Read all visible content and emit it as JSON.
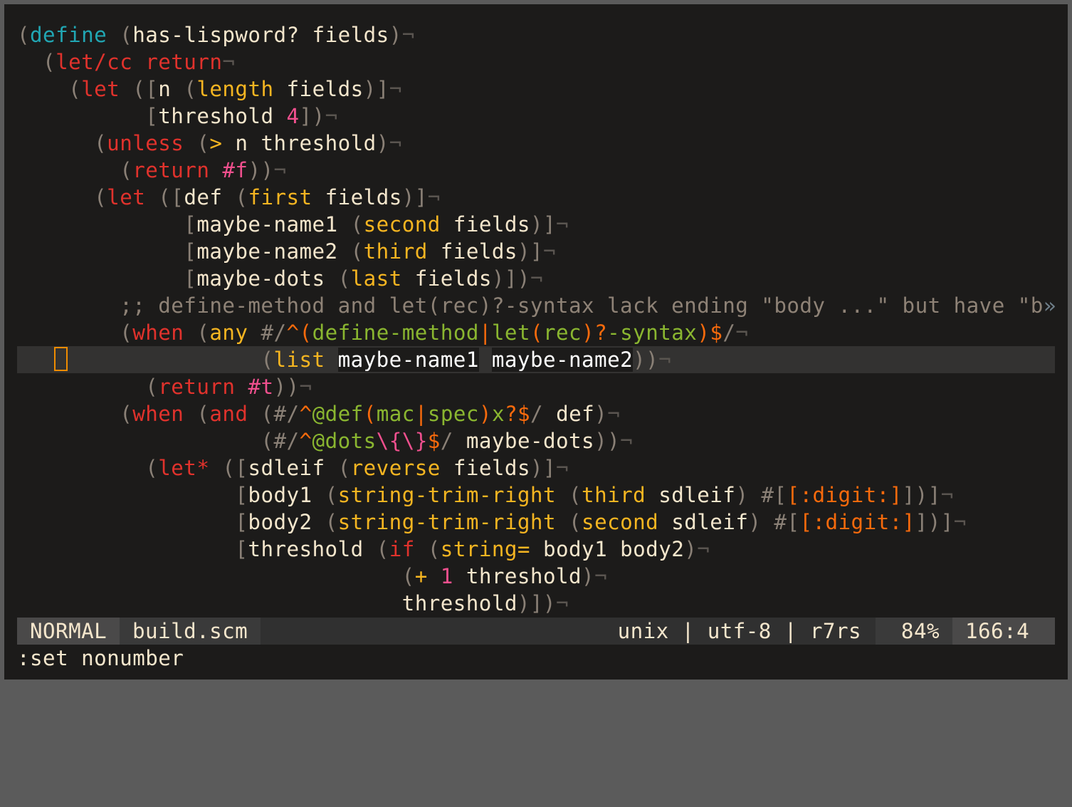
{
  "window": {
    "app": "vim",
    "file": "build.scm"
  },
  "editor": {
    "cursor": {
      "line_index": 12,
      "column": 3
    },
    "lines": [
      [
        [
          "paren",
          "("
        ],
        [
          "def",
          "define"
        ],
        [
          "id",
          " "
        ],
        [
          "paren",
          "("
        ],
        [
          "id",
          "has-lispword? fields"
        ],
        [
          "paren",
          ")"
        ],
        [
          "eol",
          "¬"
        ]
      ],
      [
        [
          "id",
          "  "
        ],
        [
          "paren",
          "("
        ],
        [
          "kw",
          "let/cc return"
        ],
        [
          "eol",
          "¬"
        ]
      ],
      [
        [
          "id",
          "    "
        ],
        [
          "paren",
          "("
        ],
        [
          "kw",
          "let"
        ],
        [
          "id",
          " "
        ],
        [
          "paren",
          "(["
        ],
        [
          "id",
          "n "
        ],
        [
          "paren",
          "("
        ],
        [
          "fn",
          "length"
        ],
        [
          "id",
          " fields"
        ],
        [
          "paren",
          ")]"
        ],
        [
          "eol",
          "¬"
        ]
      ],
      [
        [
          "id",
          "          "
        ],
        [
          "paren",
          "["
        ],
        [
          "id",
          "threshold "
        ],
        [
          "num",
          "4"
        ],
        [
          "paren",
          "])"
        ],
        [
          "eol",
          "¬"
        ]
      ],
      [
        [
          "id",
          "      "
        ],
        [
          "paren",
          "("
        ],
        [
          "kw",
          "unless"
        ],
        [
          "id",
          " "
        ],
        [
          "paren",
          "("
        ],
        [
          "fn",
          ">"
        ],
        [
          "id",
          " n threshold"
        ],
        [
          "paren",
          ")"
        ],
        [
          "eol",
          "¬"
        ]
      ],
      [
        [
          "id",
          "        "
        ],
        [
          "paren",
          "("
        ],
        [
          "kw",
          "return"
        ],
        [
          "id",
          " "
        ],
        [
          "num",
          "#f"
        ],
        [
          "paren",
          "))"
        ],
        [
          "eol",
          "¬"
        ]
      ],
      [
        [
          "id",
          "      "
        ],
        [
          "paren",
          "("
        ],
        [
          "kw",
          "let"
        ],
        [
          "id",
          " "
        ],
        [
          "paren",
          "(["
        ],
        [
          "id",
          "def "
        ],
        [
          "paren",
          "("
        ],
        [
          "fn",
          "first"
        ],
        [
          "id",
          " fields"
        ],
        [
          "paren",
          ")]"
        ],
        [
          "eol",
          "¬"
        ]
      ],
      [
        [
          "id",
          "             "
        ],
        [
          "paren",
          "["
        ],
        [
          "id",
          "maybe-name1 "
        ],
        [
          "paren",
          "("
        ],
        [
          "fn",
          "second"
        ],
        [
          "id",
          " fields"
        ],
        [
          "paren",
          ")]"
        ],
        [
          "eol",
          "¬"
        ]
      ],
      [
        [
          "id",
          "             "
        ],
        [
          "paren",
          "["
        ],
        [
          "id",
          "maybe-name2 "
        ],
        [
          "paren",
          "("
        ],
        [
          "fn",
          "third"
        ],
        [
          "id",
          " fields"
        ],
        [
          "paren",
          ")]"
        ],
        [
          "eol",
          "¬"
        ]
      ],
      [
        [
          "id",
          "             "
        ],
        [
          "paren",
          "["
        ],
        [
          "id",
          "maybe-dots "
        ],
        [
          "paren",
          "("
        ],
        [
          "fn",
          "last"
        ],
        [
          "id",
          " fields"
        ],
        [
          "paren",
          ")])"
        ],
        [
          "eol",
          "¬"
        ]
      ],
      [
        [
          "id",
          "        "
        ],
        [
          "cmt",
          ";; define-method and let(rec)?-syntax lack ending \"body ...\" but have \"b"
        ],
        [
          "more",
          "»"
        ]
      ],
      [
        [
          "id",
          "        "
        ],
        [
          "paren",
          "("
        ],
        [
          "kw",
          "when"
        ],
        [
          "id",
          " "
        ],
        [
          "paren",
          "("
        ],
        [
          "fn",
          "any"
        ],
        [
          "id",
          " "
        ],
        [
          "paren",
          "#/"
        ],
        [
          "rxop",
          "^("
        ],
        [
          "rx",
          "define-method"
        ],
        [
          "rxop",
          "|"
        ],
        [
          "rx",
          "let"
        ],
        [
          "rxop",
          "("
        ],
        [
          "rx",
          "rec"
        ],
        [
          "rxop",
          ")?"
        ],
        [
          "rx",
          "-syntax"
        ],
        [
          "rxop",
          ")$"
        ],
        [
          "paren",
          "/"
        ],
        [
          "eol",
          "¬"
        ]
      ],
      [
        [
          "id",
          "                   "
        ],
        [
          "paren",
          "("
        ],
        [
          "fn",
          "list"
        ],
        [
          "id",
          " "
        ],
        [
          "hl",
          "maybe-name1"
        ],
        [
          "id",
          " "
        ],
        [
          "hl",
          "maybe-name2"
        ],
        [
          "paren",
          "))"
        ],
        [
          "eol",
          "¬"
        ]
      ],
      [
        [
          "id",
          "          "
        ],
        [
          "paren",
          "("
        ],
        [
          "kw",
          "return"
        ],
        [
          "id",
          " "
        ],
        [
          "num",
          "#t"
        ],
        [
          "paren",
          "))"
        ],
        [
          "eol",
          "¬"
        ]
      ],
      [
        [
          "id",
          "        "
        ],
        [
          "paren",
          "("
        ],
        [
          "kw",
          "when"
        ],
        [
          "id",
          " "
        ],
        [
          "paren",
          "("
        ],
        [
          "kw",
          "and"
        ],
        [
          "id",
          " "
        ],
        [
          "paren",
          "(#/"
        ],
        [
          "rxop",
          "^"
        ],
        [
          "rx",
          "@def"
        ],
        [
          "rxop",
          "("
        ],
        [
          "rx",
          "mac"
        ],
        [
          "rxop",
          "|"
        ],
        [
          "rx",
          "spec"
        ],
        [
          "rxop",
          ")"
        ],
        [
          "rx",
          "x"
        ],
        [
          "rxop",
          "?$"
        ],
        [
          "paren",
          "/"
        ],
        [
          "id",
          " def"
        ],
        [
          "paren",
          ")"
        ],
        [
          "eol",
          "¬"
        ]
      ],
      [
        [
          "id",
          "                   "
        ],
        [
          "paren",
          "(#/"
        ],
        [
          "rxop",
          "^"
        ],
        [
          "rx",
          "@dots"
        ],
        [
          "rxesc",
          "\\{\\}"
        ],
        [
          "rxop",
          "$"
        ],
        [
          "paren",
          "/"
        ],
        [
          "id",
          " maybe-dots"
        ],
        [
          "paren",
          "))"
        ],
        [
          "eol",
          "¬"
        ]
      ],
      [
        [
          "id",
          "          "
        ],
        [
          "paren",
          "("
        ],
        [
          "kw",
          "let*"
        ],
        [
          "id",
          " "
        ],
        [
          "paren",
          "(["
        ],
        [
          "id",
          "sdleif "
        ],
        [
          "paren",
          "("
        ],
        [
          "fn",
          "reverse"
        ],
        [
          "id",
          " fields"
        ],
        [
          "paren",
          ")]"
        ],
        [
          "eol",
          "¬"
        ]
      ],
      [
        [
          "id",
          "                 "
        ],
        [
          "paren",
          "["
        ],
        [
          "id",
          "body1 "
        ],
        [
          "paren",
          "("
        ],
        [
          "fn",
          "string-trim-right"
        ],
        [
          "id",
          " "
        ],
        [
          "paren",
          "("
        ],
        [
          "fn",
          "third"
        ],
        [
          "id",
          " sdleif"
        ],
        [
          "paren",
          ")"
        ],
        [
          "id",
          " "
        ],
        [
          "paren",
          "#["
        ],
        [
          "rxop",
          "[:digit:]"
        ],
        [
          "paren",
          "])]"
        ],
        [
          "eol",
          "¬"
        ]
      ],
      [
        [
          "id",
          "                 "
        ],
        [
          "paren",
          "["
        ],
        [
          "id",
          "body2 "
        ],
        [
          "paren",
          "("
        ],
        [
          "fn",
          "string-trim-right"
        ],
        [
          "id",
          " "
        ],
        [
          "paren",
          "("
        ],
        [
          "fn",
          "second"
        ],
        [
          "id",
          " sdleif"
        ],
        [
          "paren",
          ")"
        ],
        [
          "id",
          " "
        ],
        [
          "paren",
          "#["
        ],
        [
          "rxop",
          "[:digit:]"
        ],
        [
          "paren",
          "])]"
        ],
        [
          "eol",
          "¬"
        ]
      ],
      [
        [
          "id",
          "                 "
        ],
        [
          "paren",
          "["
        ],
        [
          "id",
          "threshold "
        ],
        [
          "paren",
          "("
        ],
        [
          "kw",
          "if"
        ],
        [
          "id",
          " "
        ],
        [
          "paren",
          "("
        ],
        [
          "fn",
          "string="
        ],
        [
          "id",
          " body1 body2"
        ],
        [
          "paren",
          ")"
        ],
        [
          "eol",
          "¬"
        ]
      ],
      [
        [
          "id",
          "                              "
        ],
        [
          "paren",
          "("
        ],
        [
          "fn",
          "+"
        ],
        [
          "id",
          " "
        ],
        [
          "num",
          "1"
        ],
        [
          "id",
          " threshold"
        ],
        [
          "paren",
          ")"
        ],
        [
          "eol",
          "¬"
        ]
      ],
      [
        [
          "id",
          "                              threshold"
        ],
        [
          "paren",
          ")])"
        ],
        [
          "eol",
          "¬"
        ]
      ]
    ]
  },
  "statusline": {
    "mode": "NORMAL",
    "filename": "build.scm",
    "fileinfo": "unix | utf-8 | r7rs",
    "percent": "84%",
    "position": "166:4"
  },
  "cmdline": {
    "text": ":set nonumber"
  }
}
